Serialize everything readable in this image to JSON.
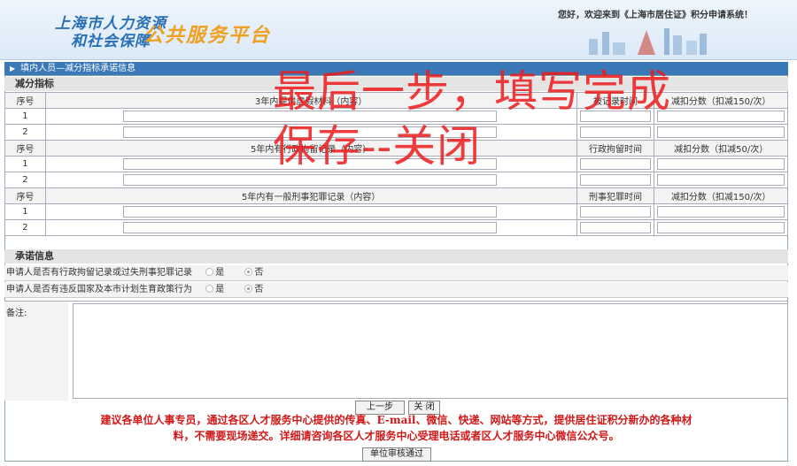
{
  "header": {
    "logo_line1": "上海市人力资源",
    "logo_line2": "和社会保障",
    "logo_platform": "公共服务平台",
    "welcome": "您好，欢迎来到《上海市居住证》积分申请系统！"
  },
  "section_bar": "填内人员—减分指标承诺信息",
  "deduction": {
    "title": "减分指标",
    "groups": [
      {
        "no_header": "序号",
        "content_header": "3年内提供虚假材料（内容）",
        "time_header": "被记录时间",
        "score_header": "减扣分数（扣减150/次）",
        "rows": [
          "1",
          "2"
        ]
      },
      {
        "no_header": "序号",
        "content_header": "5年内有行政拘留记录（内容）",
        "time_header": "行政拘留时间",
        "score_header": "减扣分数（扣减50/次）",
        "rows": [
          "1",
          "2"
        ]
      },
      {
        "no_header": "序号",
        "content_header": "5年内有一般刑事犯罪记录（内容）",
        "time_header": "刑事犯罪时间",
        "score_header": "减扣分数（扣减150/次）",
        "rows": [
          "1",
          "2"
        ]
      }
    ]
  },
  "promise": {
    "title": "承诺信息",
    "q1": "申请人是否有行政拘留记录或过失刑事犯罪记录",
    "q2": "申请人是否有违反国家及本市计划生育政策行为",
    "yes": "是",
    "no": "否",
    "selected": "否"
  },
  "remark_label": "备注:",
  "buttons": {
    "prev": "上一步",
    "close": "关 闭",
    "approve": "单位审核通过"
  },
  "notice_line1": "建议各单位人事专员，通过各区人才服务中心提供的传真、E-mail、微信、快递、网站等方式，提供居住证积分新办的各种材",
  "notice_line2": "料，不需要现场递交。详细请咨询各区人才服务中心受理电话或者区人才服务中心微信公众号。",
  "overlay": {
    "line1": "最后一步，填写完成",
    "line2": "保存--关闭",
    "color": "#ee1b1b"
  }
}
